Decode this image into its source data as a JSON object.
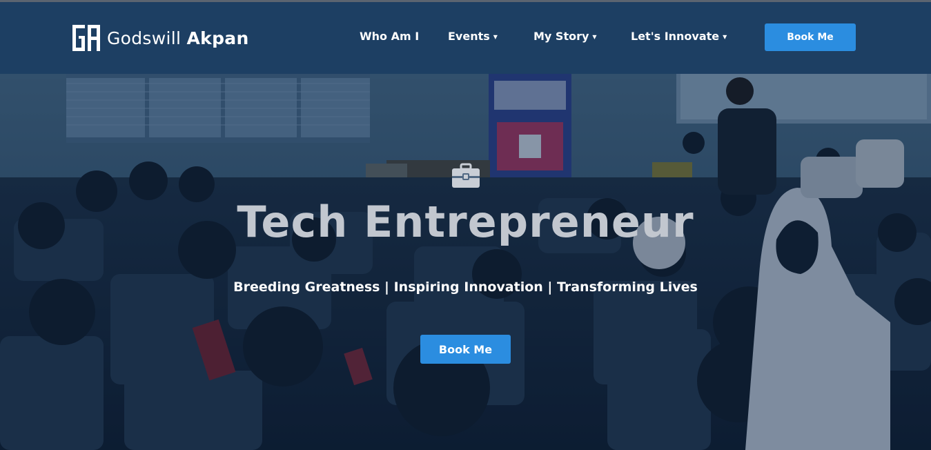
{
  "brand": {
    "first_name": "Godswill",
    "last_name": "Akpan",
    "logo_icon": "ga-monogram-logo"
  },
  "nav": {
    "items": [
      {
        "label": "Who Am I",
        "has_dropdown": false
      },
      {
        "label": "Events",
        "has_dropdown": true
      },
      {
        "label": "My Story",
        "has_dropdown": true
      },
      {
        "label": "Let's Innovate",
        "has_dropdown": true
      }
    ],
    "cta_label": "Book Me"
  },
  "hero": {
    "icon": "briefcase-icon",
    "title": "Tech Entrepreneur",
    "subtitle": "Breeding Greatness | Inspiring Innovation | Transforming Lives",
    "cta_label": "Book Me"
  },
  "colors": {
    "navbar_bg": "#1d3f63",
    "accent_button": "#2b8de0",
    "text_light": "#ffffff",
    "title_gray": "#c2c7cf"
  }
}
